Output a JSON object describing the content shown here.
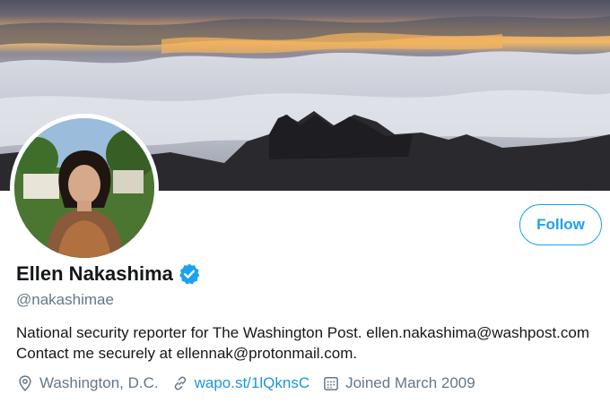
{
  "profile": {
    "name": "Ellen Nakashima",
    "handle": "@nakashimae",
    "verified": true,
    "bio_line1": "National security reporter for The Washington Post. ellen.nakashima@washpost.com",
    "bio_line2": "Contact me securely at ellennak@protonmail.com.",
    "location": "Washington, D.C.",
    "website": "wapo.st/1lQknsC",
    "joined": "Joined March 2009"
  },
  "actions": {
    "follow_label": "Follow"
  },
  "icons": {
    "verified": "verified-badge-icon",
    "location": "location-pin-icon",
    "link": "link-icon",
    "calendar": "calendar-icon"
  },
  "colors": {
    "accent": "#1da1f2",
    "link": "#1b95e0",
    "secondary_text": "#657786",
    "primary_text": "#14171a"
  }
}
